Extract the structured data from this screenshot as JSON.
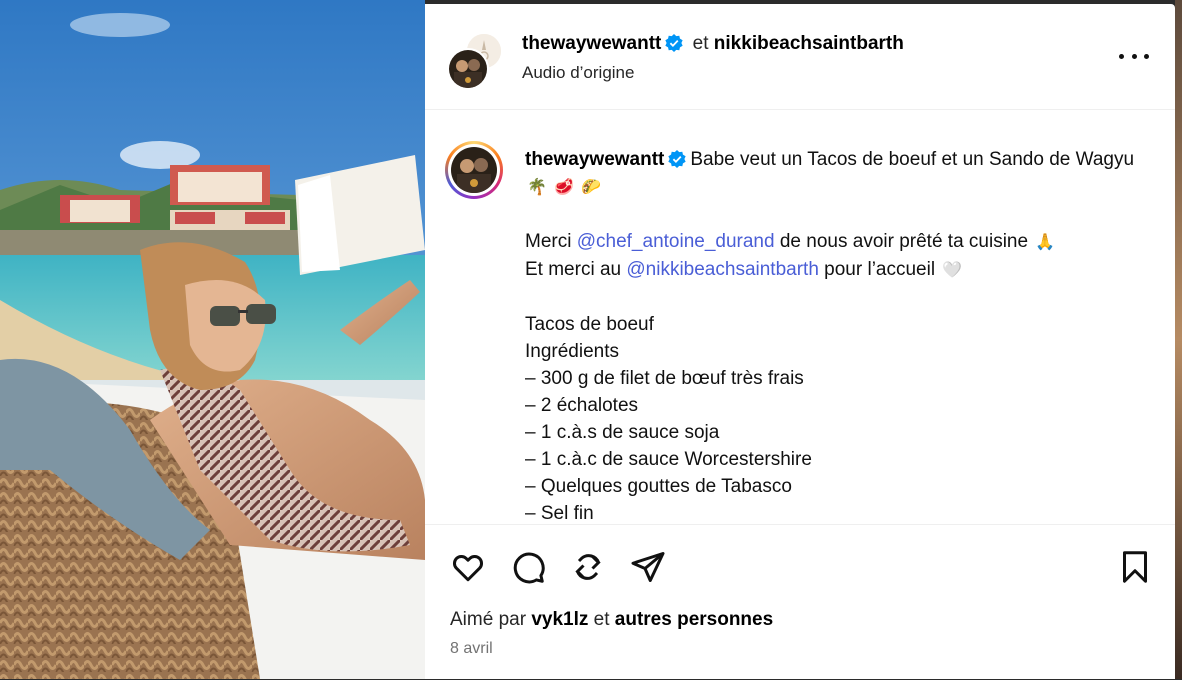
{
  "post": {
    "header": {
      "author": "thewaywewantt",
      "connector": "et",
      "collaborator": "nikkibeachsaintbarth",
      "audio": "Audio d’origine"
    },
    "caption": {
      "author": "thewaywewantt",
      "line1": "Babe veut un Tacos de boeuf et un Sando de Wagyu",
      "line1_emoji": [
        "🌴",
        "🥩",
        "🌮"
      ],
      "thanks1_pre": "Merci",
      "thanks1_mention": "@chef_antoine_durand",
      "thanks1_post": "de nous avoir prêté ta cuisine",
      "thanks1_emoji": "🙏",
      "thanks2_pre": "Et merci au",
      "thanks2_mention": "@nikkibeachsaintbarth",
      "thanks2_post": "pour l’accueil",
      "thanks2_emoji": "🤍",
      "recipe_title": "Tacos de boeuf",
      "ingredients_label": "Ingrédients",
      "ingredients": [
        "– 300 g de filet de bœuf très frais",
        "– 2 échalotes",
        "– 1 c.à.s de sauce soja",
        "– 1 c.à.c de sauce Worcestershire",
        "– Quelques gouttes de Tabasco",
        "– Sel fin"
      ]
    },
    "likes": {
      "prefix": "Aimé par",
      "user": "vyk1lz",
      "connector": "et",
      "others": "autres personnes"
    },
    "date": "8 avril"
  },
  "icons": {
    "verified_color": "#0095f6",
    "mention_color": "#4a5ed6"
  }
}
